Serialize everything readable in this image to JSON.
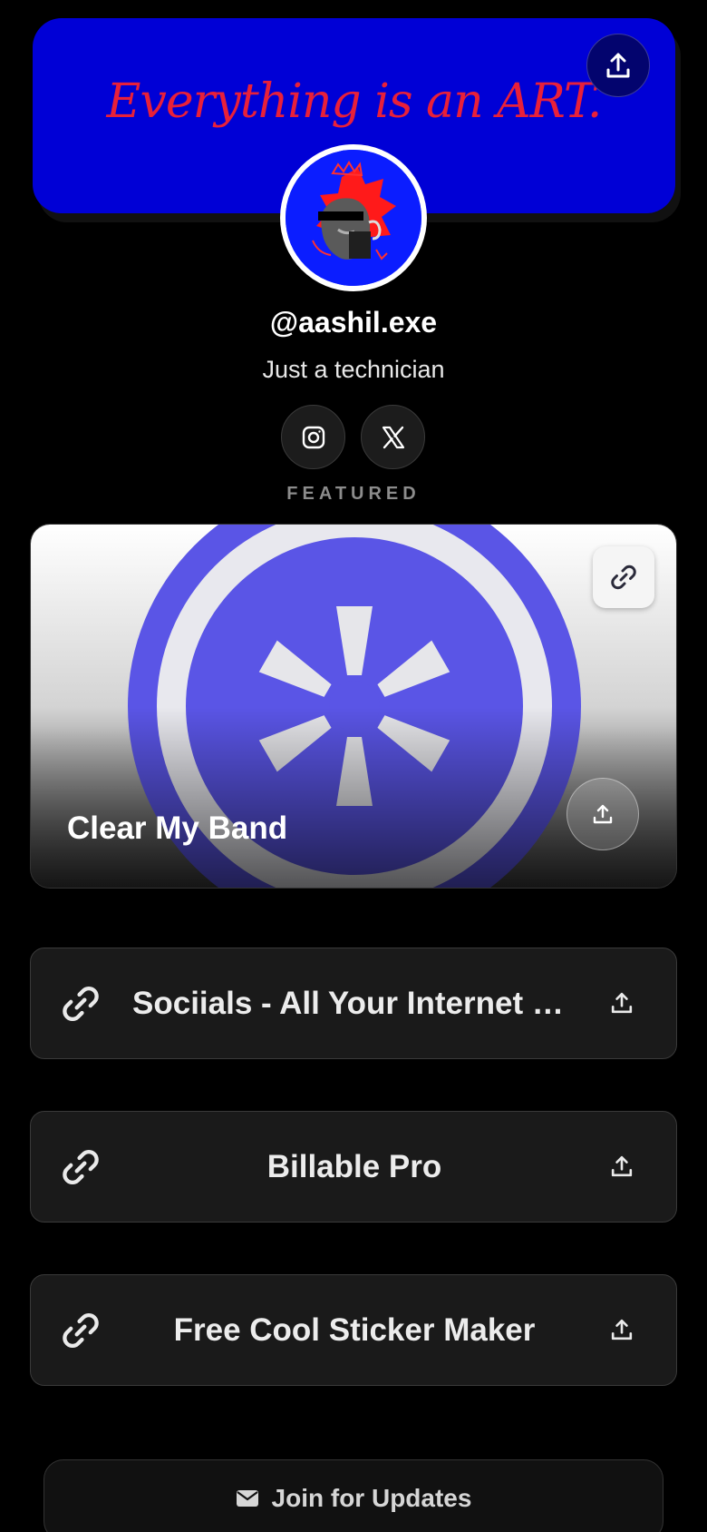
{
  "banner": {
    "text": "Everything is an ART.",
    "share_icon": "upload-share-icon",
    "bg_color": "#0000d6",
    "text_color": "#e8203a"
  },
  "profile": {
    "handle": "@aashil.exe",
    "bio": "Just a technician",
    "avatar_icon": "avatar-artwork"
  },
  "socials": [
    {
      "name": "Instagram",
      "icon": "instagram-icon"
    },
    {
      "name": "X",
      "icon": "x-icon"
    }
  ],
  "featured": {
    "label": "FEATURED",
    "card": {
      "title": "Clear My Band",
      "link_icon": "link-icon",
      "share_icon": "upload-share-icon",
      "accent": "#5a55e6"
    }
  },
  "links": [
    {
      "label": "Sociials - All Your Internet Links",
      "icon": "link-icon",
      "share_icon": "upload-share-icon"
    },
    {
      "label": "Billable Pro",
      "icon": "link-icon",
      "share_icon": "upload-share-icon"
    },
    {
      "label": "Free Cool Sticker Maker",
      "icon": "link-icon",
      "share_icon": "upload-share-icon"
    }
  ],
  "join": {
    "label": "Join for Updates",
    "icon": "envelope-icon"
  }
}
